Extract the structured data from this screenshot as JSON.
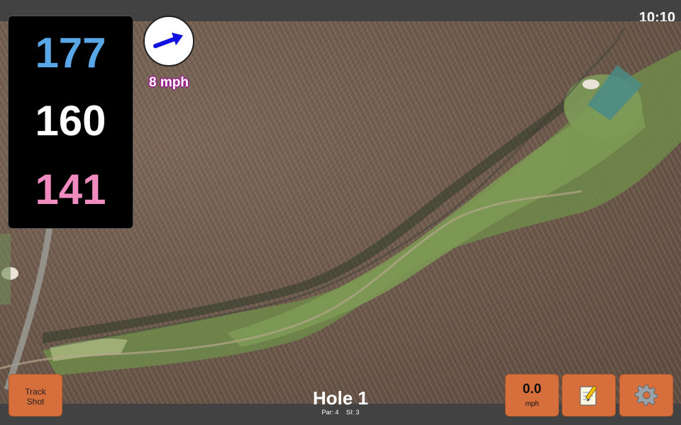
{
  "status": {
    "time": "10:10"
  },
  "yardages": {
    "back": "177",
    "middle": "160",
    "front": "141"
  },
  "wind": {
    "speed_text": "8 mph",
    "direction_icon": "wind-arrow-icon"
  },
  "hole": {
    "title": "Hole 1",
    "par": "Par: 4",
    "stroke_index": "SI: 3"
  },
  "buttons": {
    "track_shot_line1": "Track",
    "track_shot_line2": "Shot",
    "speed_value": "0.0",
    "speed_unit": "mph",
    "notes_icon": "notepad-icon",
    "settings_icon": "gear-icon"
  },
  "colors": {
    "back_yardage": "#5aa7e8",
    "middle_yardage": "#ffffff",
    "front_yardage": "#f08bbf",
    "button": "#d66f3c",
    "wind_arrow": "#1010e0"
  }
}
